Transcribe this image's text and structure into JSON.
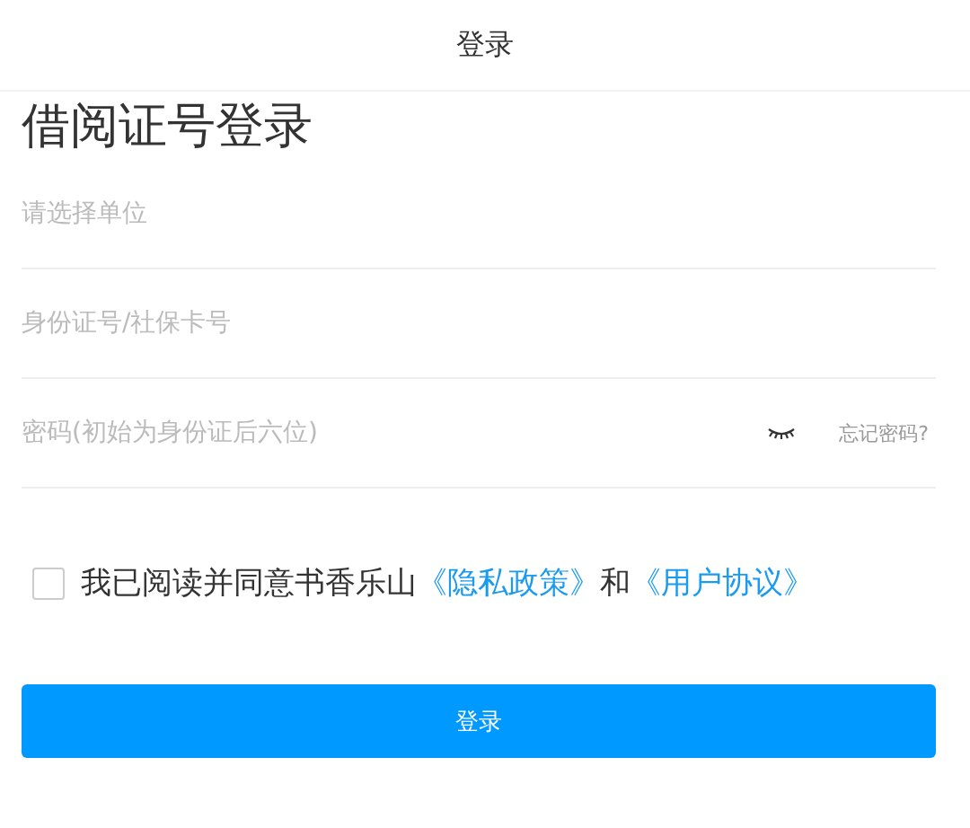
{
  "header": {
    "title": "登录"
  },
  "heading": "借阅证号登录",
  "fields": [
    {
      "kind": "select",
      "placeholder": "请选择单位"
    },
    {
      "kind": "text",
      "placeholder": "身份证号/社保卡号"
    },
    {
      "kind": "password",
      "placeholder": "密码(初始为身份证后六位)",
      "forgot": "忘记密码?"
    }
  ],
  "agreement": {
    "checked": false,
    "prefix": "我已阅读并同意书香乐山",
    "link_1": "《隐私政策》",
    "joiner": "和",
    "link_2": "《用户协议》"
  },
  "submit": "登录"
}
